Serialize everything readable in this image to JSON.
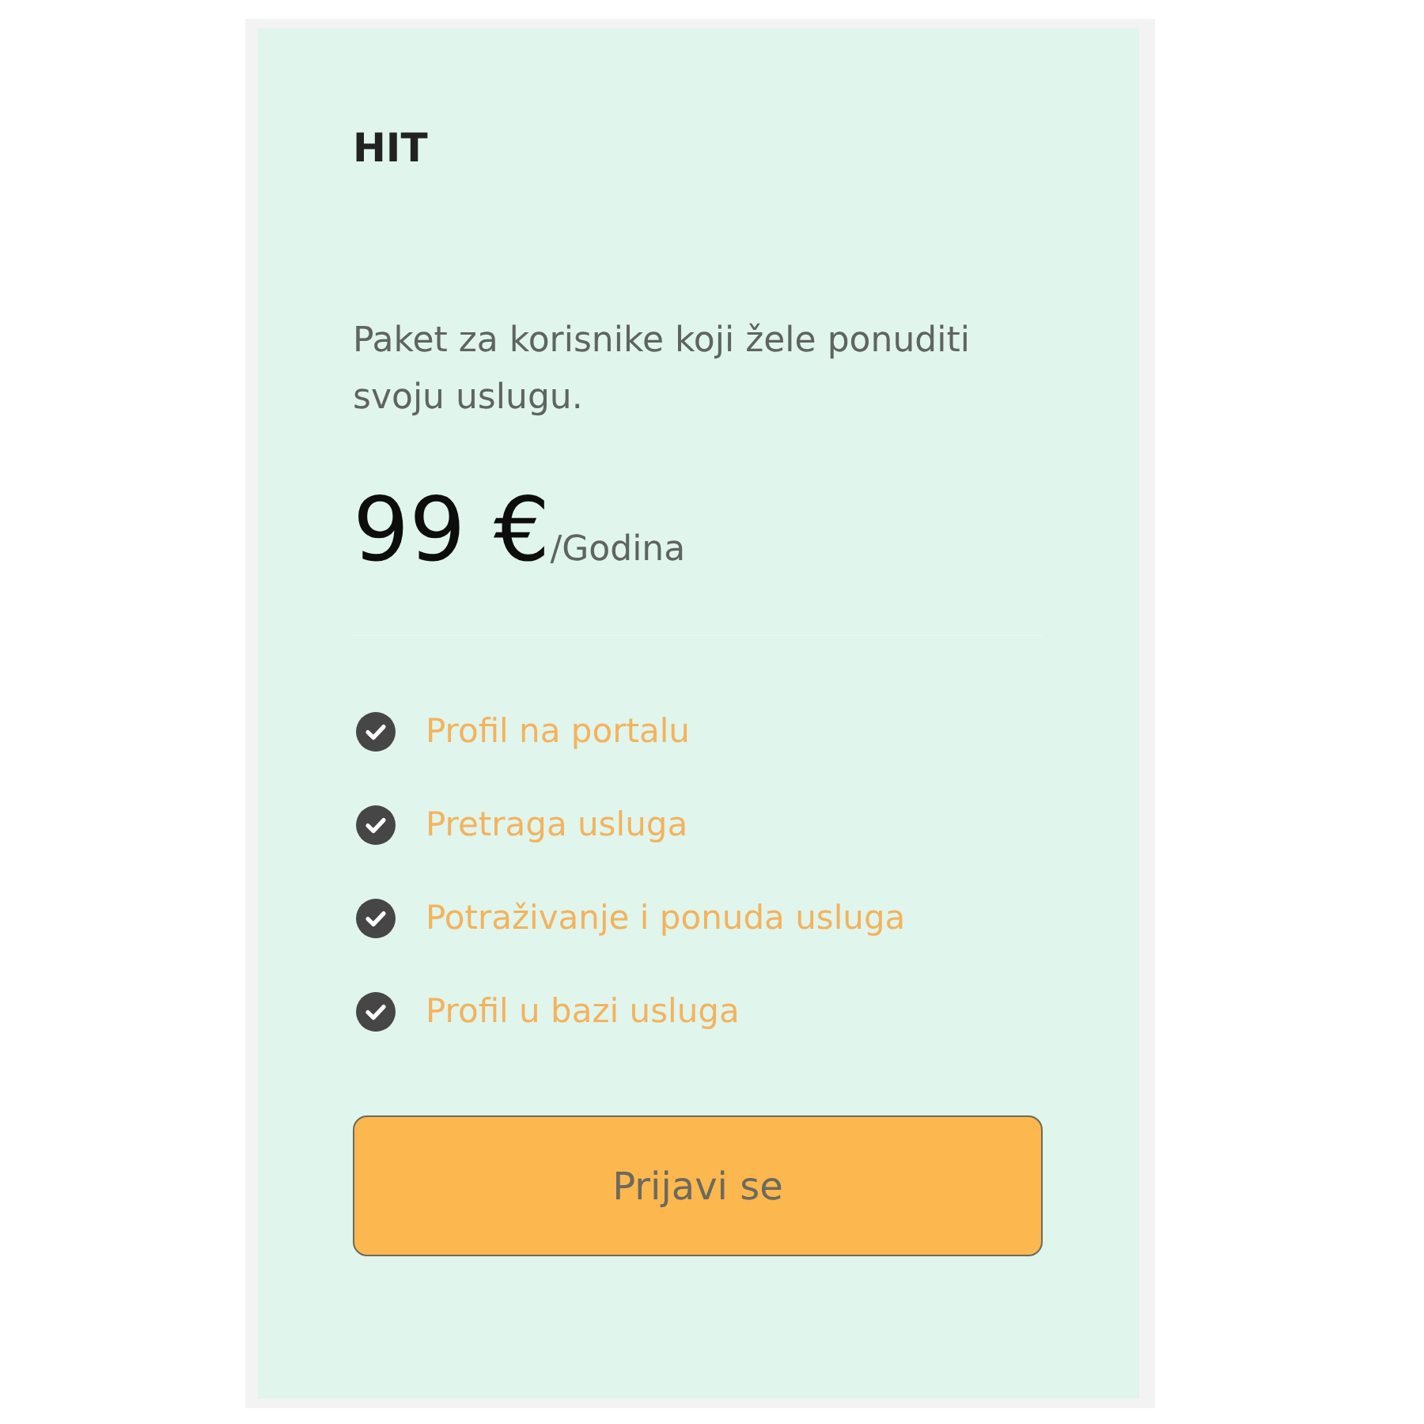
{
  "card": {
    "title": "HIT",
    "description": "Paket za korisnike koji žele ponuditi svoju uslugu.",
    "price": {
      "amount": "99 €",
      "period": "/Godina"
    },
    "features": [
      {
        "label": "Profil na portalu",
        "included": true
      },
      {
        "label": "Pretraga usluga",
        "included": true
      },
      {
        "label": "Potraživanje i ponuda usluga",
        "included": true
      },
      {
        "label": "Profil u bazi usluga",
        "included": true
      }
    ],
    "button": "Prijavi se"
  }
}
